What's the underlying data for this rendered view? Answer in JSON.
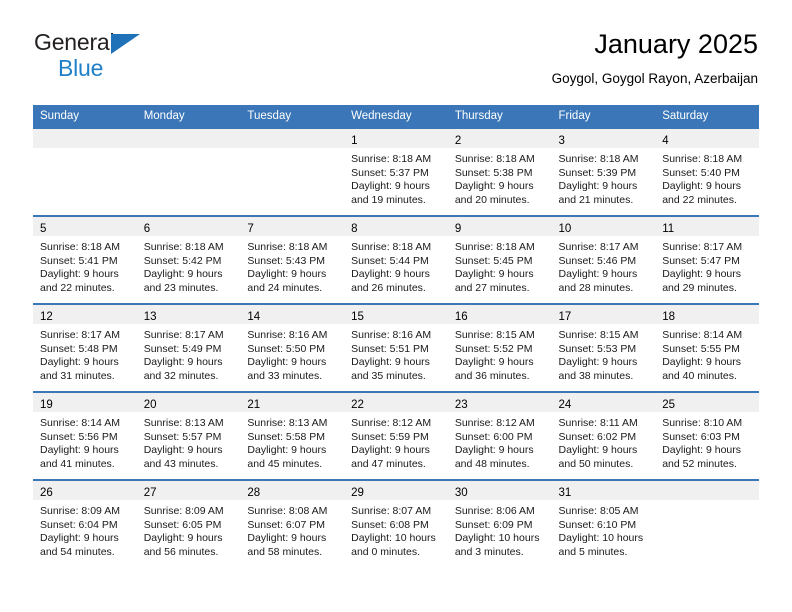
{
  "brand": {
    "name_top": "General",
    "name_bottom": "Blue",
    "triangle_color": "#1f71b8",
    "blue_text_color": "#1f80c8"
  },
  "header": {
    "title": "January 2025",
    "subtitle": "Goygol, Goygol Rayon, Azerbaijan"
  },
  "theme": {
    "header_blue": "#3a76b8",
    "daynum_band": "#f0f0f0",
    "cell_background": "#ffffff",
    "text_color": "#1a1a1a"
  },
  "calendar": {
    "weekday_headers": [
      "Sunday",
      "Monday",
      "Tuesday",
      "Wednesday",
      "Thursday",
      "Friday",
      "Saturday"
    ],
    "weeks": [
      [
        {
          "day": "",
          "lines": []
        },
        {
          "day": "",
          "lines": []
        },
        {
          "day": "",
          "lines": []
        },
        {
          "day": "1",
          "lines": [
            "Sunrise: 8:18 AM",
            "Sunset: 5:37 PM",
            "Daylight: 9 hours",
            "and 19 minutes."
          ]
        },
        {
          "day": "2",
          "lines": [
            "Sunrise: 8:18 AM",
            "Sunset: 5:38 PM",
            "Daylight: 9 hours",
            "and 20 minutes."
          ]
        },
        {
          "day": "3",
          "lines": [
            "Sunrise: 8:18 AM",
            "Sunset: 5:39 PM",
            "Daylight: 9 hours",
            "and 21 minutes."
          ]
        },
        {
          "day": "4",
          "lines": [
            "Sunrise: 8:18 AM",
            "Sunset: 5:40 PM",
            "Daylight: 9 hours",
            "and 22 minutes."
          ]
        }
      ],
      [
        {
          "day": "5",
          "lines": [
            "Sunrise: 8:18 AM",
            "Sunset: 5:41 PM",
            "Daylight: 9 hours",
            "and 22 minutes."
          ]
        },
        {
          "day": "6",
          "lines": [
            "Sunrise: 8:18 AM",
            "Sunset: 5:42 PM",
            "Daylight: 9 hours",
            "and 23 minutes."
          ]
        },
        {
          "day": "7",
          "lines": [
            "Sunrise: 8:18 AM",
            "Sunset: 5:43 PM",
            "Daylight: 9 hours",
            "and 24 minutes."
          ]
        },
        {
          "day": "8",
          "lines": [
            "Sunrise: 8:18 AM",
            "Sunset: 5:44 PM",
            "Daylight: 9 hours",
            "and 26 minutes."
          ]
        },
        {
          "day": "9",
          "lines": [
            "Sunrise: 8:18 AM",
            "Sunset: 5:45 PM",
            "Daylight: 9 hours",
            "and 27 minutes."
          ]
        },
        {
          "day": "10",
          "lines": [
            "Sunrise: 8:17 AM",
            "Sunset: 5:46 PM",
            "Daylight: 9 hours",
            "and 28 minutes."
          ]
        },
        {
          "day": "11",
          "lines": [
            "Sunrise: 8:17 AM",
            "Sunset: 5:47 PM",
            "Daylight: 9 hours",
            "and 29 minutes."
          ]
        }
      ],
      [
        {
          "day": "12",
          "lines": [
            "Sunrise: 8:17 AM",
            "Sunset: 5:48 PM",
            "Daylight: 9 hours",
            "and 31 minutes."
          ]
        },
        {
          "day": "13",
          "lines": [
            "Sunrise: 8:17 AM",
            "Sunset: 5:49 PM",
            "Daylight: 9 hours",
            "and 32 minutes."
          ]
        },
        {
          "day": "14",
          "lines": [
            "Sunrise: 8:16 AM",
            "Sunset: 5:50 PM",
            "Daylight: 9 hours",
            "and 33 minutes."
          ]
        },
        {
          "day": "15",
          "lines": [
            "Sunrise: 8:16 AM",
            "Sunset: 5:51 PM",
            "Daylight: 9 hours",
            "and 35 minutes."
          ]
        },
        {
          "day": "16",
          "lines": [
            "Sunrise: 8:15 AM",
            "Sunset: 5:52 PM",
            "Daylight: 9 hours",
            "and 36 minutes."
          ]
        },
        {
          "day": "17",
          "lines": [
            "Sunrise: 8:15 AM",
            "Sunset: 5:53 PM",
            "Daylight: 9 hours",
            "and 38 minutes."
          ]
        },
        {
          "day": "18",
          "lines": [
            "Sunrise: 8:14 AM",
            "Sunset: 5:55 PM",
            "Daylight: 9 hours",
            "and 40 minutes."
          ]
        }
      ],
      [
        {
          "day": "19",
          "lines": [
            "Sunrise: 8:14 AM",
            "Sunset: 5:56 PM",
            "Daylight: 9 hours",
            "and 41 minutes."
          ]
        },
        {
          "day": "20",
          "lines": [
            "Sunrise: 8:13 AM",
            "Sunset: 5:57 PM",
            "Daylight: 9 hours",
            "and 43 minutes."
          ]
        },
        {
          "day": "21",
          "lines": [
            "Sunrise: 8:13 AM",
            "Sunset: 5:58 PM",
            "Daylight: 9 hours",
            "and 45 minutes."
          ]
        },
        {
          "day": "22",
          "lines": [
            "Sunrise: 8:12 AM",
            "Sunset: 5:59 PM",
            "Daylight: 9 hours",
            "and 47 minutes."
          ]
        },
        {
          "day": "23",
          "lines": [
            "Sunrise: 8:12 AM",
            "Sunset: 6:00 PM",
            "Daylight: 9 hours",
            "and 48 minutes."
          ]
        },
        {
          "day": "24",
          "lines": [
            "Sunrise: 8:11 AM",
            "Sunset: 6:02 PM",
            "Daylight: 9 hours",
            "and 50 minutes."
          ]
        },
        {
          "day": "25",
          "lines": [
            "Sunrise: 8:10 AM",
            "Sunset: 6:03 PM",
            "Daylight: 9 hours",
            "and 52 minutes."
          ]
        }
      ],
      [
        {
          "day": "26",
          "lines": [
            "Sunrise: 8:09 AM",
            "Sunset: 6:04 PM",
            "Daylight: 9 hours",
            "and 54 minutes."
          ]
        },
        {
          "day": "27",
          "lines": [
            "Sunrise: 8:09 AM",
            "Sunset: 6:05 PM",
            "Daylight: 9 hours",
            "and 56 minutes."
          ]
        },
        {
          "day": "28",
          "lines": [
            "Sunrise: 8:08 AM",
            "Sunset: 6:07 PM",
            "Daylight: 9 hours",
            "and 58 minutes."
          ]
        },
        {
          "day": "29",
          "lines": [
            "Sunrise: 8:07 AM",
            "Sunset: 6:08 PM",
            "Daylight: 10 hours",
            "and 0 minutes."
          ]
        },
        {
          "day": "30",
          "lines": [
            "Sunrise: 8:06 AM",
            "Sunset: 6:09 PM",
            "Daylight: 10 hours",
            "and 3 minutes."
          ]
        },
        {
          "day": "31",
          "lines": [
            "Sunrise: 8:05 AM",
            "Sunset: 6:10 PM",
            "Daylight: 10 hours",
            "and 5 minutes."
          ]
        },
        {
          "day": "",
          "lines": []
        }
      ]
    ]
  }
}
